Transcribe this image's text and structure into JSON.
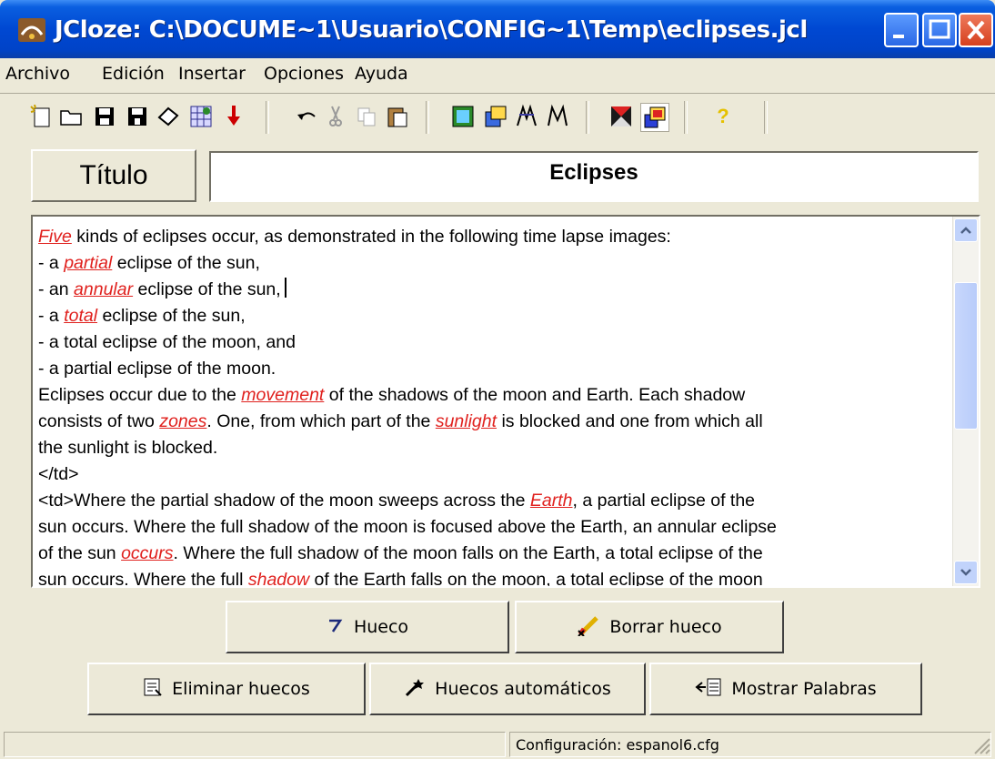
{
  "window": {
    "title": "JCloze: C:\\DOCUME~1\\Usuario\\CONFIG~1\\Temp\\eclipses.jcl"
  },
  "menu": [
    "Archivo",
    "Edición",
    "Insertar",
    "Opciones",
    "Ayuda"
  ],
  "toolbar_icons": [
    "new-document-icon",
    "open-folder-icon",
    "save-icon",
    "save-as-icon",
    "eraser-icon",
    "web-page-icon",
    "download-arrow-icon",
    "undo-icon",
    "cut-icon",
    "copy-icon",
    "paste-icon",
    "export-web-icon",
    "export-drag-icon",
    "export-html-icon",
    "export-combo-icon",
    "config-icon",
    "options-icon",
    "help-icon"
  ],
  "title_field": {
    "label": "Título",
    "value": "Eclipses"
  },
  "editor": {
    "lines": [
      [
        {
          "t": "Five",
          "gap": true
        },
        {
          "t": " kinds of eclipses occur, as demonstrated in the following time lapse images:"
        }
      ],
      [
        {
          "t": "- a "
        },
        {
          "t": "partial",
          "gap": true
        },
        {
          "t": " eclipse of the sun,"
        }
      ],
      [
        {
          "t": "- an "
        },
        {
          "t": "annular",
          "gap": true
        },
        {
          "t": " eclipse of the sun,"
        },
        {
          "t": "",
          "caret": true
        }
      ],
      [
        {
          "t": "- a "
        },
        {
          "t": "total",
          "gap": true
        },
        {
          "t": " eclipse of the sun,"
        }
      ],
      [
        {
          "t": "- a total eclipse of the moon, and"
        }
      ],
      [
        {
          "t": "- a partial eclipse of the moon."
        }
      ],
      [
        {
          "t": "Eclipses occur due to the "
        },
        {
          "t": "movement",
          "gap": true
        },
        {
          "t": " of the shadows of the moon and Earth. Each shadow"
        }
      ],
      [
        {
          "t": "consists of two "
        },
        {
          "t": "zones",
          "gap": true
        },
        {
          "t": ". One, from which part of the "
        },
        {
          "t": "sunlight",
          "gap": true
        },
        {
          "t": " is blocked and one from which all"
        }
      ],
      [
        {
          "t": "the sunlight is blocked."
        }
      ],
      [
        {
          "t": "</td>"
        }
      ],
      [
        {
          "t": "<td>Where the partial shadow of the moon sweeps across the "
        },
        {
          "t": "Earth",
          "gap": true
        },
        {
          "t": ", a partial eclipse of the"
        }
      ],
      [
        {
          "t": "sun occurs. Where the full shadow of the moon is focused above the Earth, an annular eclipse"
        }
      ],
      [
        {
          "t": "of the sun "
        },
        {
          "t": "occurs",
          "gap": true
        },
        {
          "t": ". Where the full shadow of the moon falls on the Earth, a total eclipse of the"
        }
      ],
      [
        {
          "t": "sun occurs. Where the full "
        },
        {
          "t": "shadow",
          "gap": true
        },
        {
          "t": " of the Earth falls on the moon, a total eclipse of the moon"
        }
      ]
    ]
  },
  "buttons": {
    "hueco": "Hueco",
    "borrar_hueco": "Borrar hueco",
    "eliminar_huecos": "Eliminar huecos",
    "huecos_automaticos": "Huecos automáticos",
    "mostrar_palabras": "Mostrar Palabras"
  },
  "status": {
    "config": "Configuración: espanol6.cfg"
  },
  "colors": {
    "gap_text": "#e0211e",
    "titlebar": "#0048d2",
    "face": "#ece9d8"
  }
}
